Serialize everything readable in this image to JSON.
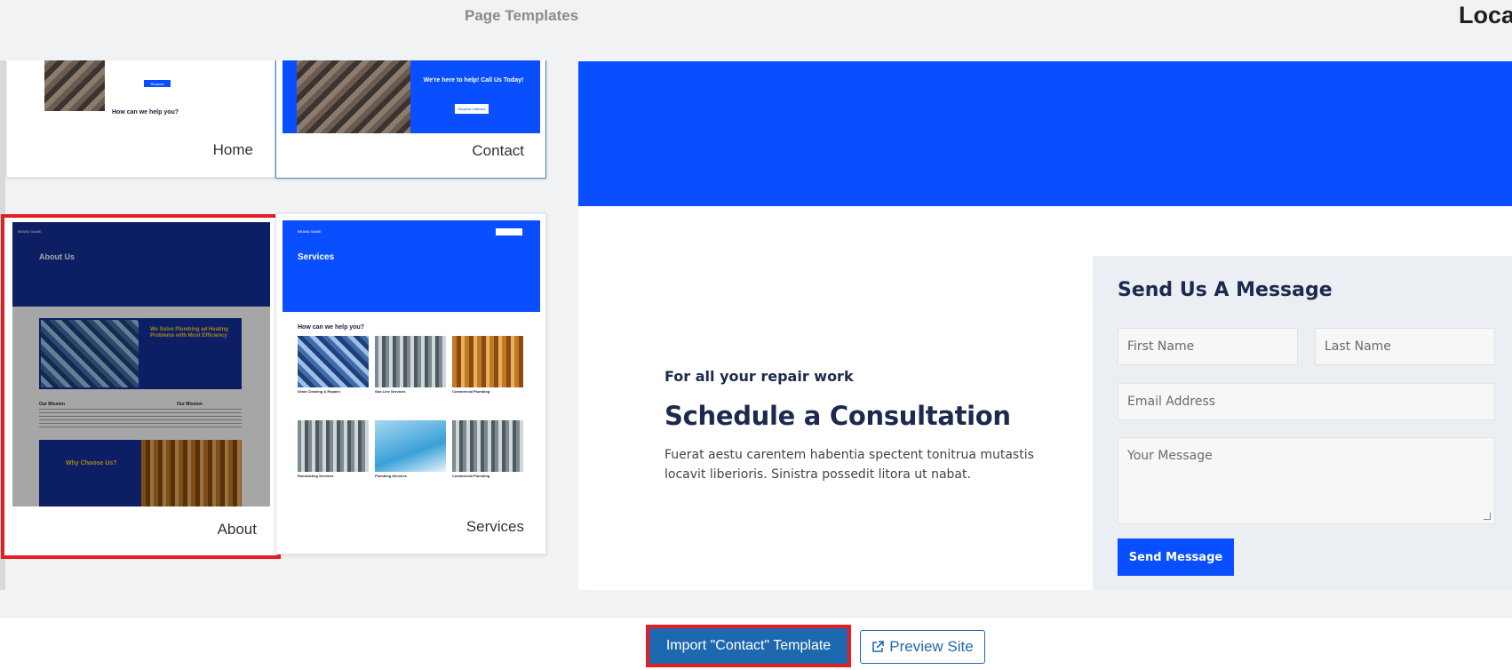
{
  "header": {
    "title": "Page Templates",
    "right_text": "Loca"
  },
  "templates": [
    {
      "label": "Home"
    },
    {
      "label": "Contact"
    },
    {
      "label": "About"
    },
    {
      "label": "Services"
    }
  ],
  "thumbs": {
    "home": {
      "cta": "Request Callback",
      "section_title": "How can we help you?"
    },
    "contact": {
      "headline": "We're here to help! Call Us Today!",
      "cta": "Request Callback"
    },
    "about": {
      "brand": "BRAND NAME",
      "nav": [
        "Home",
        "About",
        "Services",
        "Contact"
      ],
      "hero_title": "About Us",
      "feature_title": "We Solve Plumbing ad Heating Problems with Most Efficiency",
      "col1_title": "Our Mission",
      "col2_title": "Our Mission",
      "why_title": "Why Choose Us?"
    },
    "services": {
      "brand": "BRAND NAME",
      "nav": [
        "Home",
        "About",
        "Services",
        "Contact"
      ],
      "hero_title": "Services",
      "section_title": "How can we help you?",
      "items": [
        "Drain Cleaning & Repairs",
        "Gas Line Services",
        "Commercial Plumbing",
        "Remodeling Services",
        "Plumbing Services",
        "Commercial Plumbing"
      ]
    }
  },
  "preview": {
    "kicker": "For all your repair work",
    "title": "Schedule a Consultation",
    "body": "Fuerat aestu carentem habentia spectent tonitrua mutastis locavit liberioris. Sinistra possedit litora ut nabat.",
    "form": {
      "title": "Send Us A Message",
      "first_name_placeholder": "First Name",
      "last_name_placeholder": "Last Name",
      "email_placeholder": "Email Address",
      "message_placeholder": "Your Message",
      "submit_label": "Send Message"
    }
  },
  "footer": {
    "import_label": "Import \"Contact\" Template",
    "preview_label": "Preview Site"
  },
  "colors": {
    "accent_blue": "#0a4fff",
    "button_blue": "#1e68b0",
    "highlight_red": "#e21f25"
  }
}
